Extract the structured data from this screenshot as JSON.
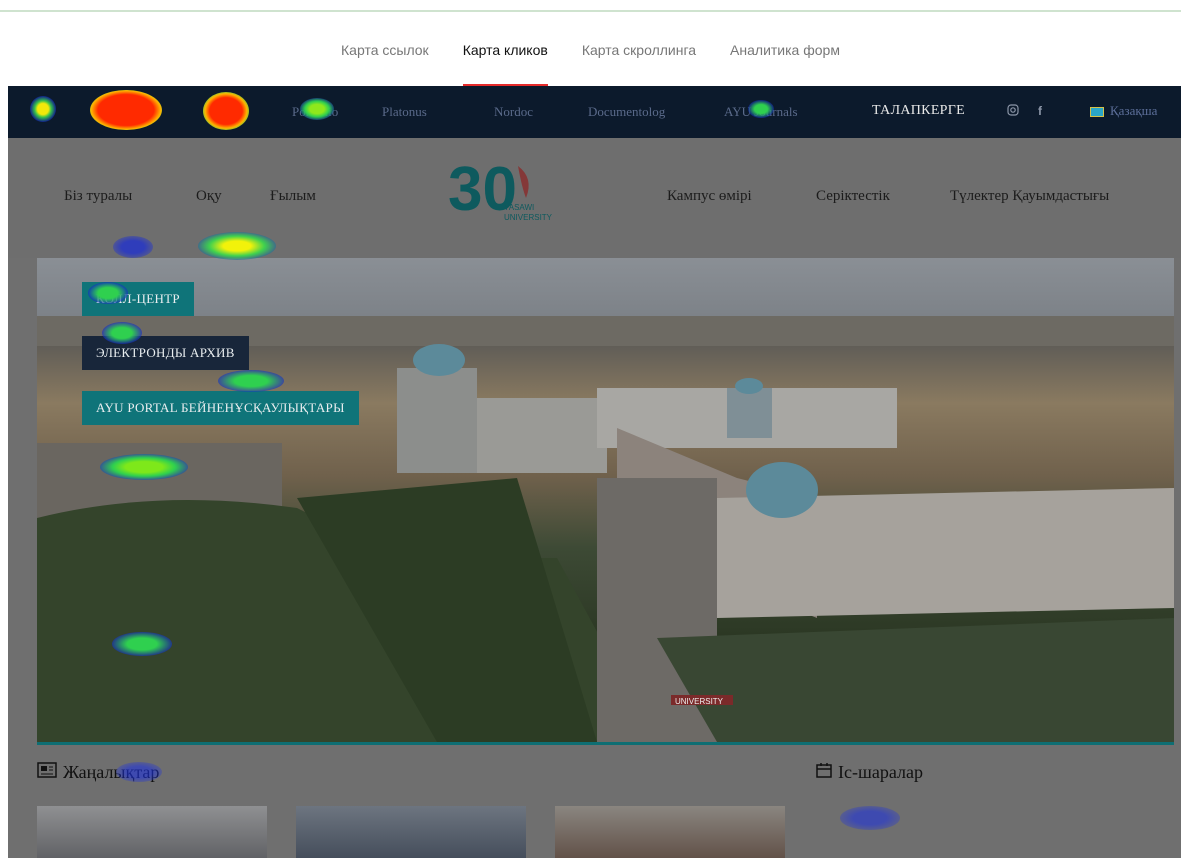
{
  "analytics_tabs": [
    {
      "label": "Карта ссылок"
    },
    {
      "label": "Карта кликов",
      "active": true
    },
    {
      "label": "Карта скроллинга"
    },
    {
      "label": "Аналитика форм"
    }
  ],
  "site": {
    "topbar": {
      "links": [
        "Portfolio",
        "Platonus",
        "Nordoc",
        "Documentolog",
        "AYU Journals"
      ],
      "apply_label": "ТАЛАПКЕРГЕ",
      "social_icons": [
        "instagram-icon",
        "facebook-icon"
      ],
      "language": "Қазақша",
      "flag_colors": [
        "#2aa6c7",
        "#d4c24a"
      ]
    },
    "mainnav": {
      "left": [
        "Біз туралы",
        "Оқу",
        "Ғылым"
      ],
      "right": [
        "Кампус өмірі",
        "Серіктестік",
        "Түлектер Қауымдастығы"
      ],
      "logo": {
        "number": "30",
        "line1": "YASAWI",
        "line2": "UNIVERSITY"
      }
    },
    "hero_buttons": [
      {
        "label": "КОЛЛ-ЦЕНТР"
      },
      {
        "label": "ЭЛЕКТРОНДЫ АРХИВ"
      },
      {
        "label": "AYU PORTAL БЕЙНЕНҰСҚАУЛЫҚТАРЫ"
      }
    ],
    "hero_sign": "UNIVERSITY",
    "sections": {
      "news": "Жаңалықтар",
      "events": "Іс-шаралар"
    }
  },
  "colors": {
    "accent_red": "#e62b2b",
    "topbar_bg": "#0c1a2c",
    "teal": "#0f7479",
    "dark_button": "#18263a"
  }
}
